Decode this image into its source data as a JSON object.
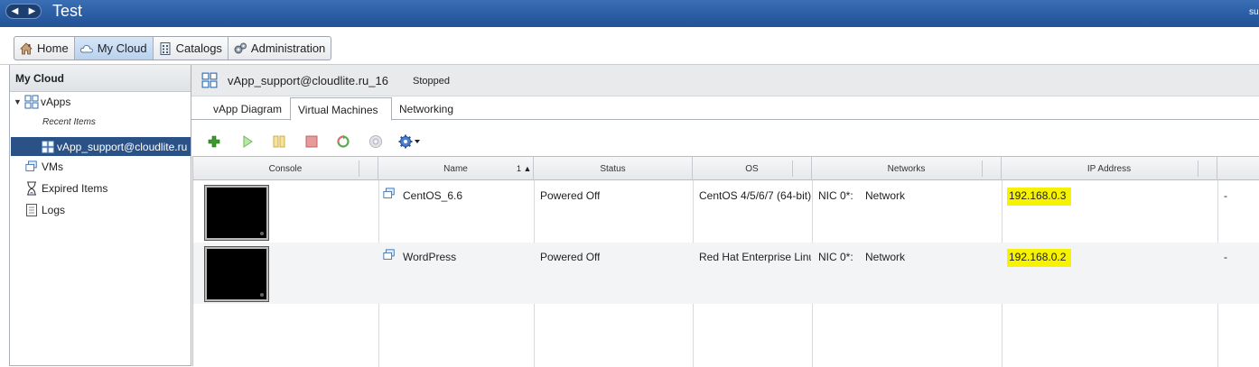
{
  "app": {
    "title": "Test",
    "user_fragment": "su"
  },
  "topnav": {
    "items": [
      {
        "label": "Home",
        "icon": "home-icon"
      },
      {
        "label": "My Cloud",
        "icon": "cloud-icon",
        "active": true
      },
      {
        "label": "Catalogs",
        "icon": "catalog-icon"
      },
      {
        "label": "Administration",
        "icon": "admin-gear-icon"
      }
    ]
  },
  "sidebar": {
    "title": "My Cloud",
    "vapps_label": "vApps",
    "recent_label": "Recent Items",
    "selected_item": "vApp_support@cloudlite.ru",
    "vms_label": "VMs",
    "expired_label": "Expired Items",
    "logs_label": "Logs"
  },
  "main": {
    "title": "vApp_support@cloudlite.ru_16",
    "status": "Stopped",
    "tabs": [
      "vApp Diagram",
      "Virtual Machines",
      "Networking"
    ],
    "active_tab": "Virtual Machines"
  },
  "toolbar": {
    "icons": [
      "add-icon",
      "power-on-icon",
      "suspend-icon",
      "power-off-icon",
      "reset-icon",
      "insert-media-icon",
      "actions-gear-icon"
    ]
  },
  "grid": {
    "columns": [
      "Console",
      "Name",
      "Status",
      "OS",
      "Networks",
      "IP Address"
    ],
    "sort_indicator": "1 ▲",
    "rows": [
      {
        "name": "CentOS_6.6",
        "status": "Powered Off",
        "os": "CentOS 4/5/6/7 (64-bit)",
        "nic": "NIC 0*:",
        "network": "Network",
        "ip": "192.168.0.3",
        "extra": "-"
      },
      {
        "name": "WordPress",
        "status": "Powered Off",
        "os": "Red Hat Enterprise Linux",
        "nic": "NIC 0*:",
        "network": "Network",
        "ip": "192.168.0.2",
        "extra": "-"
      }
    ]
  },
  "colors": {
    "titlebar": "#2a5da3",
    "selected": "#2b5286",
    "highlight": "#f7f200"
  }
}
